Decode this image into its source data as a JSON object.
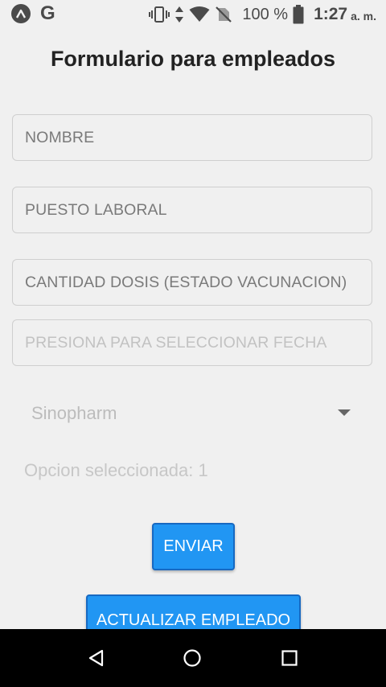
{
  "status_bar": {
    "battery": "100 %",
    "time": "1:27",
    "ampm": "a. m."
  },
  "title": "Formulario para empleados",
  "form": {
    "nombre_placeholder": "NOMBRE",
    "puesto_placeholder": "PUESTO LABORAL",
    "dosis_placeholder": "CANTIDAD DOSIS (ESTADO VACUNACION)",
    "fecha_placeholder": "PRESIONA PARA SELECCIONAR FECHA",
    "vacuna_selected": "Sinopharm",
    "opcion_text": "Opcion seleccionada: 1"
  },
  "buttons": {
    "enviar": "ENVIAR",
    "actualizar": "ACTUALIZAR EMPLEADO"
  },
  "colors": {
    "accent": "#2196f3",
    "background": "#f0f0f0"
  },
  "icons": {
    "status_left": [
      "expo-icon",
      "google-icon"
    ],
    "status_right": [
      "vibrate-icon",
      "data-arrows-icon",
      "wifi-icon",
      "no-sim-icon",
      "battery-icon"
    ],
    "nav": [
      "back-icon",
      "home-icon",
      "recent-apps-icon"
    ]
  }
}
